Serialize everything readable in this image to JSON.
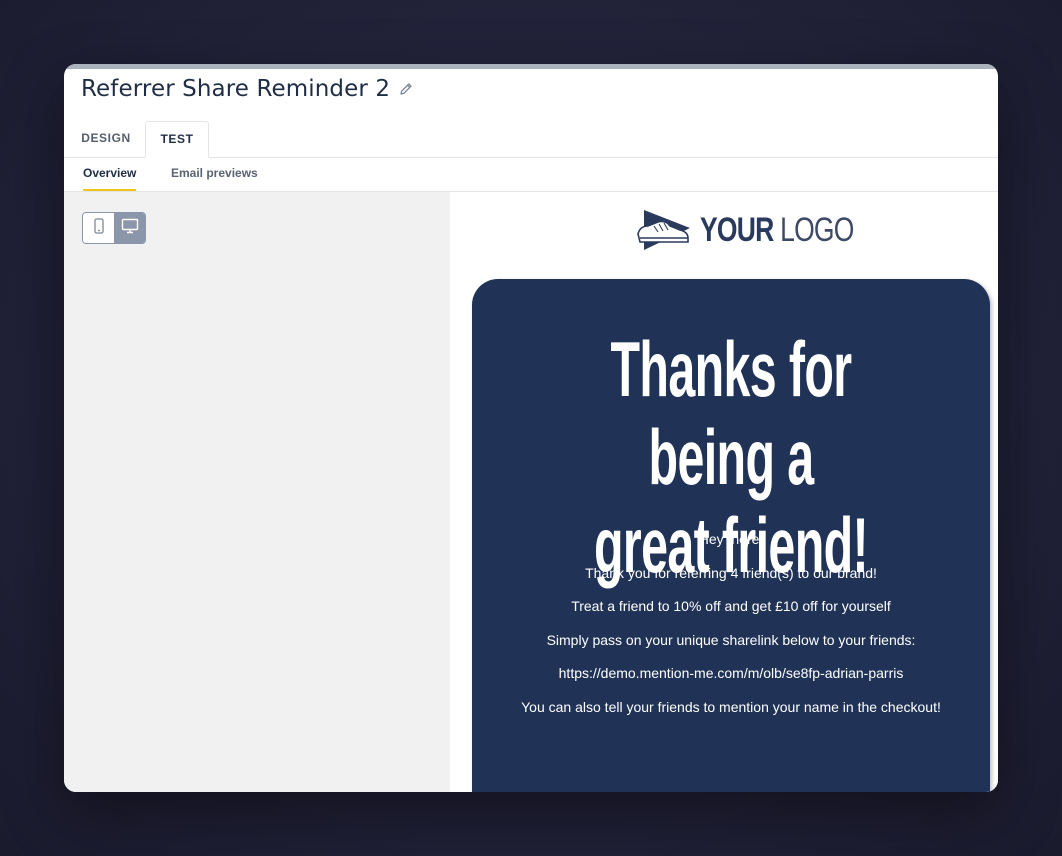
{
  "header": {
    "title": "Referrer Share Reminder 2",
    "edit_icon": "pencil-icon"
  },
  "tabs": [
    {
      "label": "DESIGN",
      "active": false
    },
    {
      "label": "TEST",
      "active": true
    }
  ],
  "subtabs": [
    {
      "label": "Overview",
      "active": true
    },
    {
      "label": "Email previews",
      "active": false
    }
  ],
  "device_toggle": {
    "options": [
      {
        "icon": "mobile-icon",
        "active": false
      },
      {
        "icon": "desktop-icon",
        "active": true
      }
    ]
  },
  "email_preview": {
    "logo": {
      "bold": "YOUR",
      "thin": "LOGO"
    },
    "headline": [
      "Thanks for being a",
      "great friend!"
    ],
    "lines": [
      "Hey there,",
      "Thank you for referring 4 friend(s) to our brand!",
      "Treat a friend to 10% off and get £10 off for yourself",
      "Simply pass on your unique sharelink below to your friends:",
      "https://demo.mention-me.com/m/olb/se8fp-adrian-parris",
      "You can also tell your friends to mention your name in the checkout!"
    ]
  },
  "colors": {
    "card_background": "#203356",
    "accent_underline": "#f2c515",
    "toggle_active": "#8b96aa"
  }
}
